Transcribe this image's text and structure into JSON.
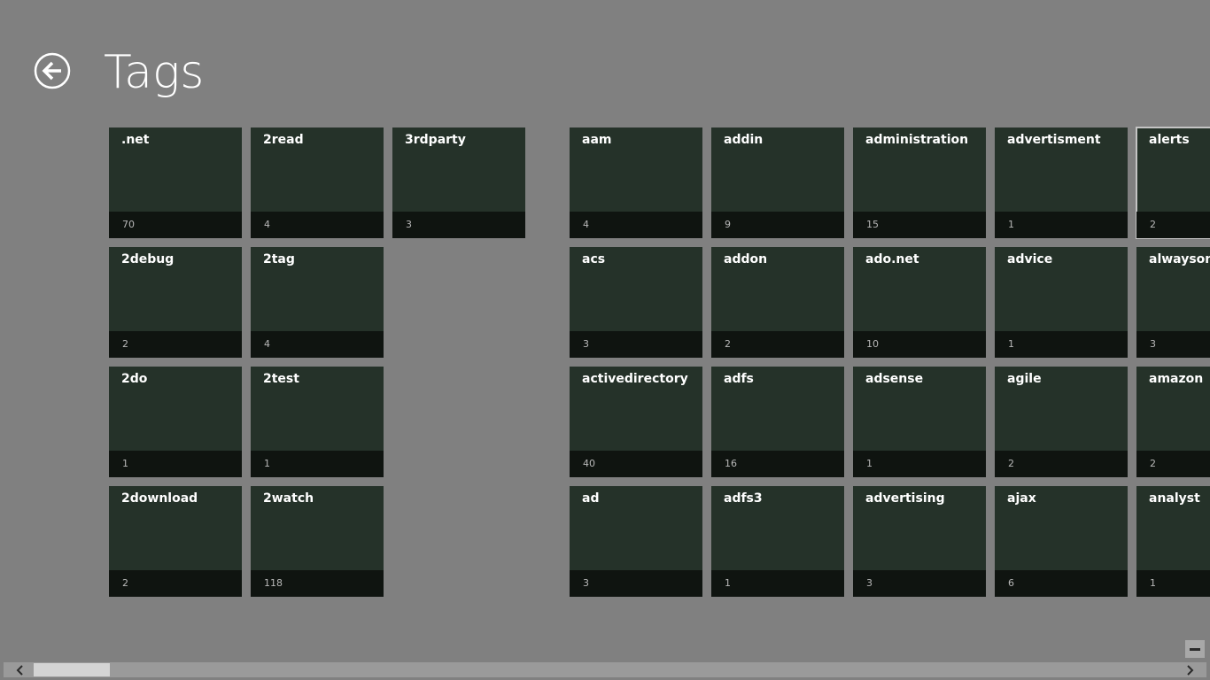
{
  "page": {
    "title": "Tags"
  },
  "groups": [
    {
      "columns": [
        [
          {
            "name": ".net",
            "count": "70"
          },
          {
            "name": "2debug",
            "count": "2"
          },
          {
            "name": "2do",
            "count": "1"
          },
          {
            "name": "2download",
            "count": "2"
          }
        ],
        [
          {
            "name": "2read",
            "count": "4"
          },
          {
            "name": "2tag",
            "count": "4"
          },
          {
            "name": "2test",
            "count": "1"
          },
          {
            "name": "2watch",
            "count": "118"
          }
        ],
        [
          {
            "name": "3rdparty",
            "count": "3"
          }
        ]
      ]
    },
    {
      "columns": [
        [
          {
            "name": "aam",
            "count": "4"
          },
          {
            "name": "acs",
            "count": "3"
          },
          {
            "name": "activedirectory",
            "count": "40"
          },
          {
            "name": "ad",
            "count": "3"
          }
        ],
        [
          {
            "name": "addin",
            "count": "9"
          },
          {
            "name": "addon",
            "count": "2"
          },
          {
            "name": "adfs",
            "count": "16"
          },
          {
            "name": "adfs3",
            "count": "1"
          }
        ],
        [
          {
            "name": "administration",
            "count": "15"
          },
          {
            "name": "ado.net",
            "count": "10"
          },
          {
            "name": "adsense",
            "count": "1"
          },
          {
            "name": "advertising",
            "count": "3"
          }
        ],
        [
          {
            "name": "advertisment",
            "count": "1"
          },
          {
            "name": "advice",
            "count": "1"
          },
          {
            "name": "agile",
            "count": "2"
          },
          {
            "name": "ajax",
            "count": "6"
          }
        ],
        [
          {
            "name": "alerts",
            "count": "2",
            "selected": true
          },
          {
            "name": "alwayson",
            "count": "3"
          },
          {
            "name": "amazon",
            "count": "2"
          },
          {
            "name": "analyst",
            "count": "1"
          }
        ]
      ]
    }
  ],
  "colors": {
    "background": "#808080",
    "tile": "#253229",
    "tile_footer": "#0f1410",
    "selection_outline": "#c4c4c4"
  },
  "icons": {
    "back": "back-arrow-icon",
    "scroll_left": "chevron-left-icon",
    "scroll_right": "chevron-right-icon",
    "zoom": "minus-icon"
  }
}
